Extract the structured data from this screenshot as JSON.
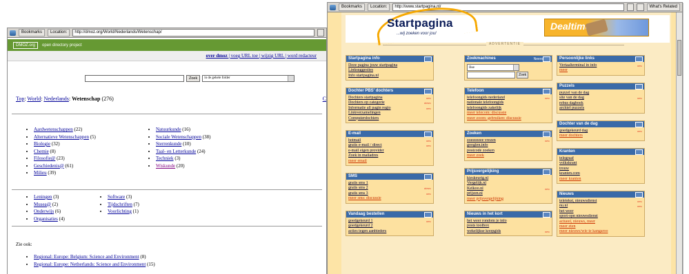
{
  "left_window": {
    "toolbar": {
      "bookmarks": "Bookmarks",
      "location": "Location:",
      "url": "http://dmoz.org/World/Nederlands/Wetenschap/"
    },
    "dmoz_logo": "DMOZ.org",
    "dmoz_tagline": "open directory project",
    "top_links": [
      {
        "label": "over dmoz",
        "visited": false
      },
      {
        "label": "| voeg URL toe",
        "visited": false
      },
      {
        "label": "| wijzig URL",
        "visited": false
      },
      {
        "label": "| word redacteur",
        "visited": false
      }
    ],
    "search_button": "Zoek",
    "search_scope": "in de gehele folder",
    "crumbs": [
      {
        "label": "Top",
        "link": true
      },
      {
        "label": ": ",
        "link": false
      },
      {
        "label": "World",
        "link": true
      },
      {
        "label": ": ",
        "link": false
      },
      {
        "label": "Nederlands",
        "link": true
      },
      {
        "label": ": ",
        "link": false
      }
    ],
    "crumb_current": "Wetenschap",
    "crumb_count": "(276)",
    "crumb_right": "C",
    "col1": [
      {
        "label": "Aardwetenschappen",
        "count": "(22)"
      },
      {
        "label": "Alternatieve Wetenschappen",
        "count": "(5)"
      },
      {
        "label": "Biologie",
        "count": "(32)"
      },
      {
        "label": "Chemie",
        "count": "(8)"
      },
      {
        "label": "Filosofie@",
        "count": "(23)"
      },
      {
        "label": "Geschiedenis@",
        "count": "(61)"
      },
      {
        "label": "Milieu",
        "count": "(39)"
      }
    ],
    "col2": [
      {
        "label": "Natuurkunde",
        "count": "(16)",
        "visited": false
      },
      {
        "label": "Sociale Wetenschappen",
        "count": "(38)",
        "visited": false
      },
      {
        "label": "Sterrenkunde",
        "count": "(10)",
        "visited": false
      },
      {
        "label": "Taal- en Letterkunde",
        "count": "(24)",
        "visited": false
      },
      {
        "label": "Techniek",
        "count": "(3)",
        "visited": false
      },
      {
        "label": "Wiskunde",
        "count": "(20)",
        "visited": true
      }
    ],
    "col3": [
      {
        "label": "Leningen",
        "count": "(3)"
      },
      {
        "label": "Musea@",
        "count": "(2)"
      },
      {
        "label": "Onderwijs",
        "count": "(6)"
      },
      {
        "label": "Organisaties",
        "count": "(4)"
      }
    ],
    "col4": [
      {
        "label": "Software",
        "count": "(3)"
      },
      {
        "label": "Tijdschriften",
        "count": "(7)"
      },
      {
        "label": "Voorlichting",
        "count": "(1)"
      }
    ],
    "see_also": "Zie ook:",
    "see_also_items": [
      {
        "label": "Regional: Europe: Belgium: Science and Environment",
        "count": "(8)"
      },
      {
        "label": "Regional: Europe: Netherlands: Science and Environment",
        "count": "(15)"
      }
    ]
  },
  "right_window": {
    "toolbar": {
      "bookmarks": "Bookmarks",
      "location": "Location:",
      "url": "http://www.startpagina.nl/",
      "whats_related": "What's Related"
    },
    "title": "Startpagina",
    "subtitle": "...wij zoeken voor jou!",
    "banner_text": "Dealtime",
    "divider_label": "ADVERTENTIE",
    "col1": [
      {
        "title": "Startpagina info",
        "items": [
          {
            "t": "Deze pagina jouw startpagina"
          },
          {
            "t": "Linksuggesties"
          },
          {
            "t": "Info startpagina.nl"
          }
        ]
      },
      {
        "title": "Dochter PBS' dochters",
        "items": [
          {
            "t": "Dochters startpagina",
            "nw": "new"
          },
          {
            "t": "Dochters op categorie",
            "nw": "nieuw"
          },
          {
            "t": "Informatie all pagin regio",
            "nw": "new"
          },
          {
            "t": "Linkverzamelingen"
          },
          {
            "t": "Computerdochters"
          }
        ]
      },
      {
        "title": "E-mail",
        "items": [
          {
            "t": "hotmail",
            "nw": "new"
          },
          {
            "t": "gratis e-mail / direct",
            "nw": "new"
          },
          {
            "t": "e-mail eigen provider"
          },
          {
            "t": "Zoek in mailadres"
          },
          {
            "t": "meer email",
            "red": true
          }
        ]
      },
      {
        "title": "SMS",
        "items": [
          {
            "t": "gratis sms 1"
          },
          {
            "t": "gratis sms 2",
            "nw": "nieuw"
          },
          {
            "t": "gratis sms 3",
            "nw": "new"
          },
          {
            "t": "meer sms: discussie",
            "red": true
          }
        ]
      },
      {
        "title": "Vandaag bestellen",
        "items": [
          {
            "t": "goedgekeurd 1",
            "nw": "new"
          },
          {
            "t": "goedgekeurd 2"
          },
          {
            "t": "acties tegen aanbieders"
          }
        ]
      }
    ],
    "col2": [
      {
        "title": "Zoekmachines",
        "ctl": "Neers",
        "items": [],
        "select": "Ilse",
        "button": "Zoek"
      },
      {
        "title": "Telefoon",
        "items": [
          {
            "t": "telefoongids nederland",
            "nw": "new"
          },
          {
            "t": "nationale telefoongids"
          },
          {
            "t": "telefoongids zakelijk"
          },
          {
            "t": "meer telecom: discussie",
            "red": true
          },
          {
            "t": "meer zoom: gebruiken: discussie",
            "red": true
          }
        ]
      },
      {
        "title": "Zoeken",
        "items": [
          {
            "t": "zoeeeeeee vrezen",
            "nw": "new"
          },
          {
            "t": "googlen.info"
          },
          {
            "t": "postcode zoeken"
          },
          {
            "t": "meer zoek",
            "red": true
          }
        ]
      },
      {
        "title": "Prijsvergelijking",
        "items": [
          {
            "t": "kieskeurig.nl"
          },
          {
            "t": "Vergelijk.nl"
          },
          {
            "t": "Kelkoo.nl",
            "nw": "new"
          },
          {
            "t": "prijzen.nl"
          },
          {
            "t": "meer prijsvergelijking",
            "red": true
          }
        ]
      },
      {
        "title": "Nieuws in het kort",
        "items": [
          {
            "t": "het weer rondom je info"
          },
          {
            "t": "posts toolbox"
          },
          {
            "t": "wekelijkse koopgids",
            "nw": "new"
          }
        ]
      }
    ],
    "col3": [
      {
        "title": "Persoonlijke links",
        "items": [
          {
            "t": "Vertaalterminal in info",
            "nw": "new"
          },
          {
            "t": "meer",
            "red": true
          }
        ]
      },
      {
        "title": "Puzzels",
        "items": [
          {
            "t": "puzzel van de dag"
          },
          {
            "t": "site van de dag",
            "nw": "new"
          },
          {
            "t": "rebus dagboek"
          },
          {
            "t": "archief puzzels"
          }
        ]
      },
      {
        "title": "Dochter van de dag",
        "items": [
          {
            "t": "goedgekeurd dag",
            "nw": "new"
          },
          {
            "t": "meer dochters",
            "red": true
          }
        ]
      },
      {
        "title": "Kranten",
        "items": [
          {
            "t": "telegraaf"
          },
          {
            "t": "volkskrant"
          },
          {
            "t": "trouw"
          },
          {
            "t": "kranten.com"
          },
          {
            "t": "meer kranten",
            "red": true
          }
        ]
      },
      {
        "title": "Nieuws",
        "items": [
          {
            "t": "teletekst, nieuwsdienst",
            "nw": "new"
          },
          {
            "t": "nu.nl",
            "nw": "new"
          },
          {
            "t": "het weer"
          },
          {
            "t": "sport-opn nieuwsdienst"
          },
          {
            "t": "actueel, nieuws, meer",
            "red": true
          },
          {
            "t": "meer eten",
            "red": true
          },
          {
            "t": "meer nieuws/wie te kangaroo",
            "red": true
          }
        ]
      }
    ]
  },
  "colors": {
    "dmoz_green": "#669933",
    "link_blue": "#000099",
    "visited": "#800080",
    "sp_header_blue": "#3a6aa8",
    "sp_panel": "#fde1a0",
    "sp_accent": "#f6a800",
    "sp_title": "#0b1c58"
  }
}
